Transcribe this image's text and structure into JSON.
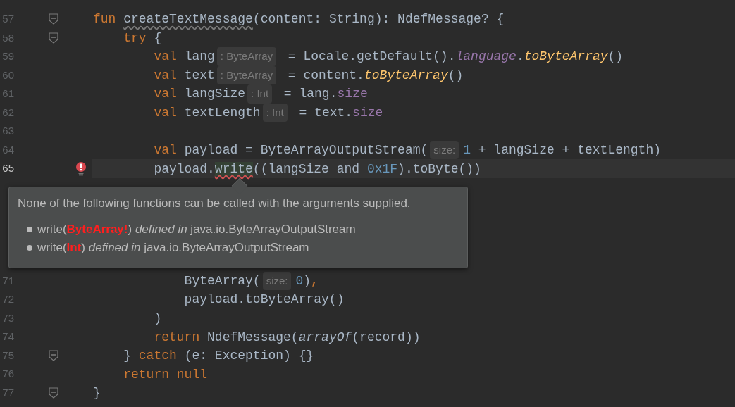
{
  "editor": {
    "lines": [
      {
        "number": "57",
        "fold": true,
        "current": false,
        "error": false,
        "tokens": [
          {
            "kind": "keyword",
            "text": "fun "
          },
          {
            "kind": "decl-warn",
            "text": "createTextMessage"
          },
          {
            "kind": "plain",
            "text": "(content: String): NdefMessage? {"
          }
        ]
      },
      {
        "number": "58",
        "fold": true,
        "current": false,
        "error": false,
        "tokens": [
          {
            "kind": "keyword",
            "text": "    try"
          },
          {
            "kind": "plain",
            "text": " {"
          }
        ]
      },
      {
        "number": "59",
        "fold": false,
        "current": false,
        "error": false,
        "tokens": [
          {
            "kind": "keyword",
            "text": "        val"
          },
          {
            "kind": "plain",
            "text": " lang"
          },
          {
            "kind": "hint",
            "text": ": ByteArray"
          },
          {
            "kind": "plain",
            "text": " = Locale.getDefault()."
          },
          {
            "kind": "prop-italic",
            "text": "language"
          },
          {
            "kind": "plain",
            "text": "."
          },
          {
            "kind": "ext-fn",
            "text": "toByteArray"
          },
          {
            "kind": "plain",
            "text": "()"
          }
        ]
      },
      {
        "number": "60",
        "fold": false,
        "current": false,
        "error": false,
        "tokens": [
          {
            "kind": "keyword",
            "text": "        val"
          },
          {
            "kind": "plain",
            "text": " text"
          },
          {
            "kind": "hint",
            "text": ": ByteArray"
          },
          {
            "kind": "plain",
            "text": " = content."
          },
          {
            "kind": "ext-fn",
            "text": "toByteArray"
          },
          {
            "kind": "plain",
            "text": "()"
          }
        ]
      },
      {
        "number": "61",
        "fold": false,
        "current": false,
        "error": false,
        "tokens": [
          {
            "kind": "keyword",
            "text": "        val"
          },
          {
            "kind": "plain",
            "text": " langSize"
          },
          {
            "kind": "hint",
            "text": ": Int"
          },
          {
            "kind": "plain",
            "text": " = lang."
          },
          {
            "kind": "prop",
            "text": "size"
          }
        ]
      },
      {
        "number": "62",
        "fold": false,
        "current": false,
        "error": false,
        "tokens": [
          {
            "kind": "keyword",
            "text": "        val"
          },
          {
            "kind": "plain",
            "text": " textLength"
          },
          {
            "kind": "hint",
            "text": ": Int"
          },
          {
            "kind": "plain",
            "text": " = text."
          },
          {
            "kind": "prop",
            "text": "size"
          }
        ]
      },
      {
        "number": "63",
        "fold": false,
        "current": false,
        "error": false
      },
      {
        "number": "64",
        "fold": false,
        "current": false,
        "error": false,
        "tokens": [
          {
            "kind": "keyword",
            "text": "        val"
          },
          {
            "kind": "plain",
            "text": " payload = ByteArrayOutputStream("
          },
          {
            "kind": "hint",
            "text": "size:"
          },
          {
            "kind": "number",
            "text": "1"
          },
          {
            "kind": "plain",
            "text": " + langSize + textLength)"
          }
        ]
      },
      {
        "number": "65",
        "fold": false,
        "current": true,
        "error": true,
        "tokens": [
          {
            "kind": "plain",
            "text": "        payload."
          },
          {
            "kind": "error-ref",
            "text": "write"
          },
          {
            "kind": "plain",
            "text": "((langSize and "
          },
          {
            "kind": "number",
            "text": "0x1F"
          },
          {
            "kind": "plain",
            "text": ").toByte())"
          }
        ],
        "tooltip": {
          "message": "None of the following functions can be called with the arguments supplied.",
          "items": [
            "write(**ByteArray!**) *defined in* java.io.ByteArrayOutputStream",
            "write(**Int**) *defined in* java.io.ByteArrayOutputStream"
          ]
        }
      },
      {
        "number": "71",
        "fold": false,
        "current": false,
        "error": false,
        "tokens": [
          {
            "kind": "plain",
            "text": "            ByteArray("
          },
          {
            "kind": "hint",
            "text": "size:"
          },
          {
            "kind": "number",
            "text": "0"
          },
          {
            "kind": "plain",
            "text": ")"
          },
          {
            "kind": "keyword",
            "text": ","
          }
        ]
      },
      {
        "number": "72",
        "fold": false,
        "current": false,
        "error": false,
        "tokens": [
          {
            "kind": "plain",
            "text": "            payload.toByteArray()"
          }
        ]
      },
      {
        "number": "73",
        "fold": false,
        "current": false,
        "error": false,
        "tokens": [
          {
            "kind": "plain",
            "text": "        )"
          }
        ]
      },
      {
        "number": "74",
        "fold": false,
        "current": false,
        "error": false,
        "tokens": [
          {
            "kind": "keyword",
            "text": "        return"
          },
          {
            "kind": "plain",
            "text": " NdefMessage("
          },
          {
            "kind": "fn-italic",
            "text": "arrayOf"
          },
          {
            "kind": "plain",
            "text": "(record))"
          }
        ]
      },
      {
        "number": "75",
        "fold": true,
        "current": false,
        "error": false,
        "tokens": [
          {
            "kind": "plain",
            "text": "    } "
          },
          {
            "kind": "keyword",
            "text": "catch"
          },
          {
            "kind": "plain",
            "text": " (e: Exception) {}"
          }
        ]
      },
      {
        "number": "76",
        "fold": false,
        "current": false,
        "error": false,
        "tokens": [
          {
            "kind": "keyword",
            "text": "    return null"
          }
        ]
      },
      {
        "number": "77",
        "fold": true,
        "current": false,
        "error": false,
        "tokens": [
          {
            "kind": "plain",
            "text": "}"
          }
        ]
      }
    ]
  }
}
